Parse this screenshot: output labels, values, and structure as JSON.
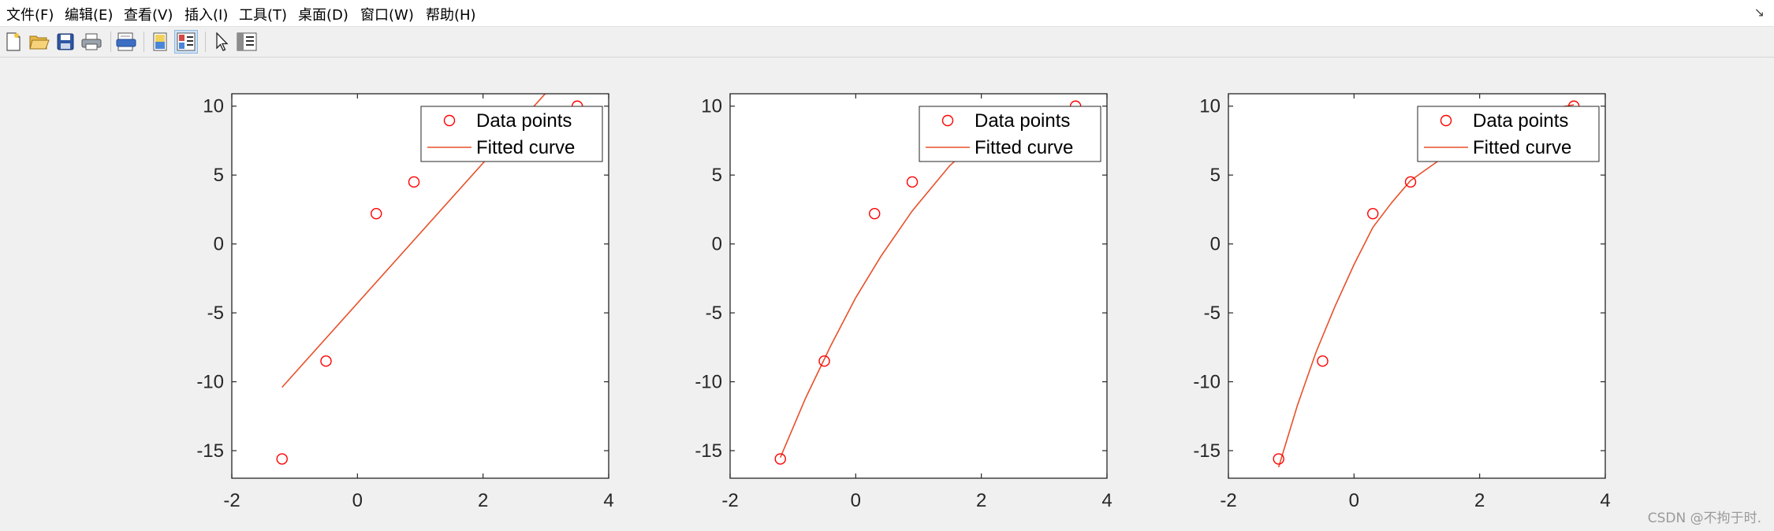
{
  "menu": {
    "items": [
      {
        "label": "文件(F)"
      },
      {
        "label": "编辑(E)"
      },
      {
        "label": "查看(V)"
      },
      {
        "label": "插入(I)"
      },
      {
        "label": "工具(T)"
      },
      {
        "label": "桌面(D)"
      },
      {
        "label": "窗口(W)"
      },
      {
        "label": "帮助(H)"
      }
    ],
    "corner_glyph": "↘"
  },
  "toolbar": {
    "buttons": [
      {
        "icon": "new-figure-icon"
      },
      {
        "icon": "open-file-icon"
      },
      {
        "icon": "save-icon"
      },
      {
        "icon": "print-icon"
      },
      {
        "icon": "print-preview-icon"
      },
      {
        "icon": "hide-plot-tools-icon"
      },
      {
        "icon": "show-plot-tools-icon",
        "active": true
      },
      {
        "icon": "edit-plot-cursor-icon"
      },
      {
        "icon": "property-editor-icon"
      }
    ]
  },
  "colors": {
    "data_points": "#ff0000",
    "fitted_curve": "#e8502a",
    "axes": "#262626",
    "plot_background": "#ffffff",
    "figure_background": "#f0f0f0"
  },
  "chart_data": [
    {
      "type": "scatter",
      "xlim": [
        -2,
        4
      ],
      "ylim": [
        -17,
        10.9
      ],
      "xticks": [
        "-2",
        "0",
        "2",
        "4"
      ],
      "yticks": [
        "-15",
        "-10",
        "-5",
        "0",
        "5",
        "10"
      ],
      "grid": false,
      "legend_location": "top-right",
      "points": {
        "name": "Data points",
        "x": [
          -1.2,
          -0.5,
          0.3,
          0.9,
          3.5
        ],
        "y": [
          -15.6,
          -8.5,
          2.2,
          4.5,
          10.0
        ]
      },
      "fit": {
        "name": "Fitted curve",
        "x": [
          -1.2,
          3.5
        ],
        "y": [
          -10.4,
          13.5
        ]
      }
    },
    {
      "type": "scatter",
      "xlim": [
        -2,
        4
      ],
      "ylim": [
        -17,
        10.9
      ],
      "xticks": [
        "-2",
        "0",
        "2",
        "4"
      ],
      "yticks": [
        "-15",
        "-10",
        "-5",
        "0",
        "5",
        "10"
      ],
      "grid": false,
      "legend_location": "top-right",
      "points": {
        "name": "Data points",
        "x": [
          -1.2,
          -0.5,
          0.3,
          0.9,
          3.5
        ],
        "y": [
          -15.6,
          -8.5,
          2.2,
          4.5,
          10.0
        ]
      },
      "fit": {
        "name": "Fitted curve",
        "x": [
          -1.2,
          -0.8,
          -0.4,
          0.0,
          0.4,
          0.9,
          1.5,
          2.0,
          2.5,
          3.0,
          3.5
        ],
        "y": [
          -15.5,
          -11.2,
          -7.4,
          -3.9,
          -0.9,
          2.4,
          5.7,
          7.7,
          9.1,
          9.8,
          9.9
        ]
      }
    },
    {
      "type": "scatter",
      "xlim": [
        -2,
        4
      ],
      "ylim": [
        -17,
        10.9
      ],
      "xticks": [
        "-2",
        "0",
        "2",
        "4"
      ],
      "yticks": [
        "-15",
        "-10",
        "-5",
        "0",
        "5",
        "10"
      ],
      "grid": false,
      "legend_location": "top-right",
      "points": {
        "name": "Data points",
        "x": [
          -1.2,
          -0.5,
          0.3,
          0.9,
          3.5
        ],
        "y": [
          -15.6,
          -8.5,
          2.2,
          4.5,
          10.0
        ]
      },
      "fit": {
        "name": "Fitted curve",
        "x": [
          -1.2,
          -0.9,
          -0.6,
          -0.3,
          0.0,
          0.3,
          0.6,
          0.9,
          1.3,
          1.7,
          2.2,
          2.7,
          3.1,
          3.5
        ],
        "y": [
          -16.2,
          -11.7,
          -7.8,
          -4.5,
          -1.5,
          1.2,
          3.0,
          4.6,
          5.9,
          7.1,
          8.3,
          9.3,
          9.8,
          10.1
        ]
      }
    }
  ],
  "watermark": "CSDN @不拘于时."
}
